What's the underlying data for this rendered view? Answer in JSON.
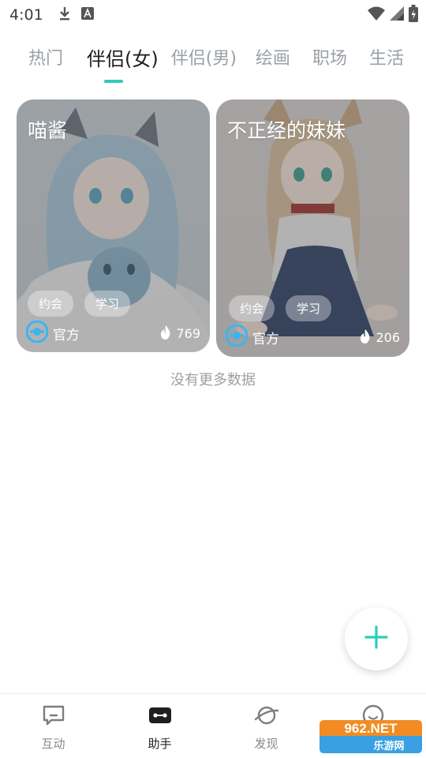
{
  "status_bar": {
    "time": "4:01",
    "icons": [
      "download-icon",
      "font-icon",
      "wifi-icon",
      "signal-icon",
      "battery-icon"
    ]
  },
  "tabs": [
    {
      "label": "热门",
      "active": false
    },
    {
      "label": "伴侣(女)",
      "active": true
    },
    {
      "label": "伴侣(男)",
      "active": false
    },
    {
      "label": "绘画",
      "active": false
    },
    {
      "label": "职场",
      "active": false
    },
    {
      "label": "生活",
      "active": false
    }
  ],
  "accent_color": "#2ccdb8",
  "cards": [
    {
      "title": "喵酱",
      "tags": [
        "约会",
        "学习"
      ],
      "source": "官方",
      "count": "769",
      "background": "light-blue anime cat-girl illustration"
    },
    {
      "title": "不正经的妹妹",
      "tags": [
        "约会",
        "学习"
      ],
      "source": "官方",
      "count": "206",
      "background": "fox-ear anime girl illustration"
    }
  ],
  "empty_note": "没有更多数据",
  "fab": {
    "icon": "plus-icon"
  },
  "bottom_nav": [
    {
      "label": "互动",
      "icon": "chat-icon",
      "active": false
    },
    {
      "label": "助手",
      "icon": "robot-icon",
      "active": true
    },
    {
      "label": "发现",
      "icon": "planet-icon",
      "active": false
    },
    {
      "label": "",
      "icon": "smile-icon",
      "active": false
    }
  ],
  "watermark": {
    "text_top": "962.NET",
    "text_bottom": "乐游网"
  }
}
